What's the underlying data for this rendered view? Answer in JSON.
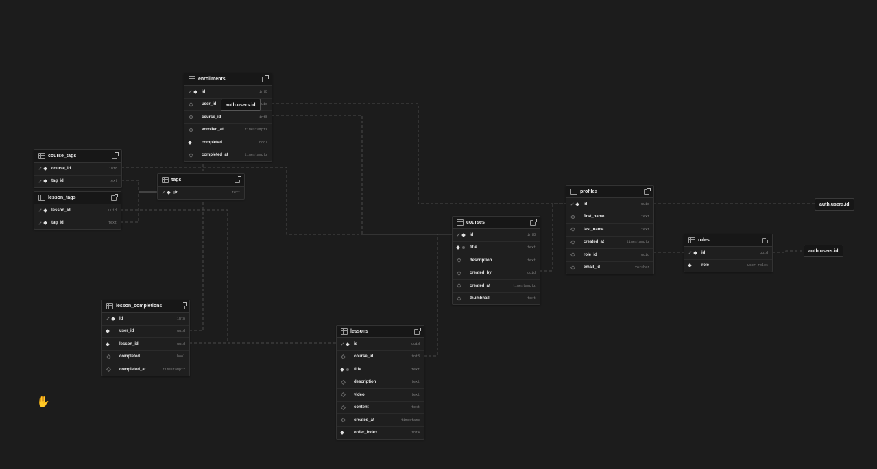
{
  "canvas": {
    "background": "#1c1c1c",
    "edge_color": "#4a4a4a"
  },
  "tables": {
    "enrollments": {
      "name": "enrollments",
      "columns": [
        {
          "name": "id",
          "type": "int8",
          "key": true,
          "marker": "solid"
        },
        {
          "name": "user_id",
          "type": "uuid",
          "marker": "hollow"
        },
        {
          "name": "course_id",
          "type": "int8",
          "marker": "hollow"
        },
        {
          "name": "enrolled_at",
          "type": "timestamptz",
          "marker": "hollow"
        },
        {
          "name": "completed",
          "type": "bool",
          "marker": "solid"
        },
        {
          "name": "completed_at",
          "type": "timestamptz",
          "marker": "hollow"
        }
      ]
    },
    "course_tags": {
      "name": "course_tags",
      "columns": [
        {
          "name": "course_id",
          "type": "int8",
          "key": true,
          "marker": "solid"
        },
        {
          "name": "tag_id",
          "type": "text",
          "key": true,
          "marker": "solid"
        }
      ]
    },
    "tags": {
      "name": "tags",
      "columns": [
        {
          "name": "id",
          "type": "text",
          "key": true,
          "marker": "solid",
          "unique": true
        }
      ]
    },
    "lesson_tags": {
      "name": "lesson_tags",
      "columns": [
        {
          "name": "lesson_id",
          "type": "uuid",
          "key": true,
          "marker": "solid"
        },
        {
          "name": "tag_id",
          "type": "text",
          "key": true,
          "marker": "solid"
        }
      ]
    },
    "lesson_completions": {
      "name": "lesson_completions",
      "columns": [
        {
          "name": "id",
          "type": "int8",
          "key": true,
          "marker": "solid"
        },
        {
          "name": "user_id",
          "type": "uuid",
          "marker": "solid"
        },
        {
          "name": "lesson_id",
          "type": "uuid",
          "marker": "solid"
        },
        {
          "name": "completed",
          "type": "bool",
          "marker": "hollow"
        },
        {
          "name": "completed_at",
          "type": "timestamptz",
          "marker": "hollow"
        }
      ]
    },
    "lessons": {
      "name": "lessons",
      "columns": [
        {
          "name": "id",
          "type": "uuid",
          "key": true,
          "marker": "solid"
        },
        {
          "name": "course_id",
          "type": "int8",
          "marker": "hollow"
        },
        {
          "name": "title",
          "type": "text",
          "marker": "solid",
          "unique": true
        },
        {
          "name": "description",
          "type": "text",
          "marker": "hollow"
        },
        {
          "name": "video",
          "type": "text",
          "marker": "hollow"
        },
        {
          "name": "content",
          "type": "text",
          "marker": "hollow"
        },
        {
          "name": "created_at",
          "type": "timestamp",
          "marker": "hollow"
        },
        {
          "name": "order_index",
          "type": "int4",
          "marker": "solid"
        }
      ]
    },
    "courses": {
      "name": "courses",
      "columns": [
        {
          "name": "id",
          "type": "int8",
          "key": true,
          "marker": "solid"
        },
        {
          "name": "title",
          "type": "text",
          "marker": "solid",
          "unique": true
        },
        {
          "name": "description",
          "type": "text",
          "marker": "hollow"
        },
        {
          "name": "created_by",
          "type": "uuid",
          "marker": "hollow"
        },
        {
          "name": "created_at",
          "type": "timestamptz",
          "marker": "hollow"
        },
        {
          "name": "thumbnail",
          "type": "text",
          "marker": "hollow"
        }
      ]
    },
    "profiles": {
      "name": "profiles",
      "columns": [
        {
          "name": "id",
          "type": "uuid",
          "key": true,
          "marker": "solid"
        },
        {
          "name": "first_name",
          "type": "text",
          "marker": "hollow"
        },
        {
          "name": "last_name",
          "type": "text",
          "marker": "hollow"
        },
        {
          "name": "created_at",
          "type": "timestamptz",
          "marker": "hollow"
        },
        {
          "name": "role_id",
          "type": "uuid",
          "marker": "hollow"
        },
        {
          "name": "email_id",
          "type": "varchar",
          "marker": "hollow"
        }
      ]
    },
    "roles": {
      "name": "roles",
      "columns": [
        {
          "name": "id",
          "type": "uuid",
          "key": true,
          "marker": "solid"
        },
        {
          "name": "role",
          "type": "user_roles",
          "marker": "solid"
        }
      ]
    }
  },
  "external_refs": {
    "tooltip": "auth.users.id",
    "profiles_ref": "auth.users.id",
    "roles_ref": "auth.users.id"
  },
  "cursor": {
    "icon": "hand-grab-icon",
    "glyph": "✋"
  }
}
